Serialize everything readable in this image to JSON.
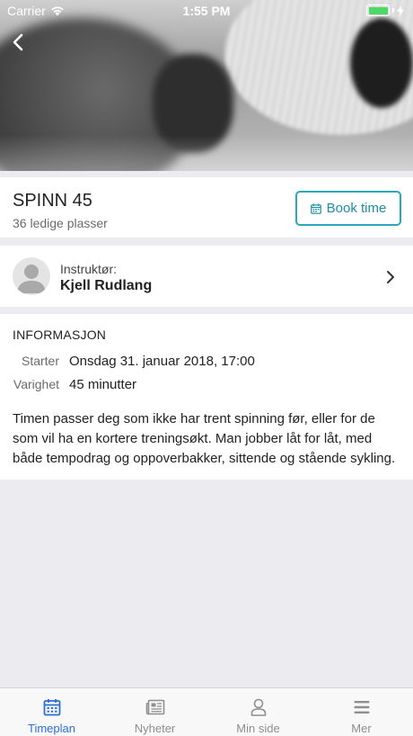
{
  "status_bar": {
    "carrier": "Carrier",
    "time": "1:55 PM"
  },
  "class": {
    "name": "SPINN 45",
    "spots": "36 ledige plasser",
    "book_label": "Book time"
  },
  "instructor": {
    "label": "Instruktør:",
    "name": "Kjell Rudlang"
  },
  "info": {
    "heading": "INFORMASJON",
    "start_label": "Starter",
    "start_value": "Onsdag 31. januar 2018, 17:00",
    "duration_label": "Varighet",
    "duration_value": "45 minutter",
    "description": "Timen passer deg som ikke har trent spinning før, eller for de som vil ha en kortere treningsøkt. Man jobber låt for låt, med både tempodrag og oppoverbakker, sittende og stående sykling."
  },
  "tabs": [
    {
      "label": "Timeplan",
      "icon": "calendar-icon",
      "active": true
    },
    {
      "label": "Nyheter",
      "icon": "newspaper-icon",
      "active": false
    },
    {
      "label": "Min side",
      "icon": "person-icon",
      "active": false
    },
    {
      "label": "Mer",
      "icon": "menu-icon",
      "active": false
    }
  ],
  "colors": {
    "accent": "#2aa6bd",
    "tab_active": "#2b6fd6",
    "battery": "#4cd964",
    "background": "#ebebf0"
  }
}
